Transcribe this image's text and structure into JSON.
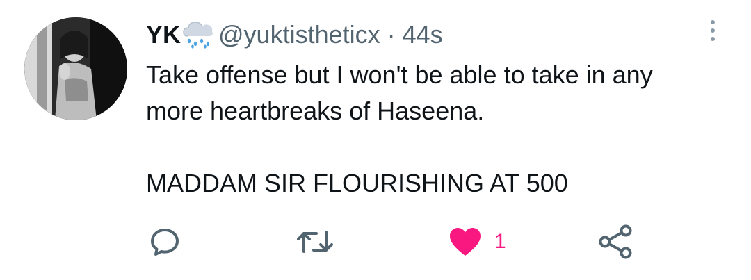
{
  "tweet": {
    "author": {
      "name": "YK",
      "emoji_icon": "cloud-with-rain-icon",
      "handle": "@yuktistheticx",
      "separator": "·",
      "time": "44s"
    },
    "text_lines": [
      "Take offense but I won't be able to take in any",
      "more heartbreaks of Haseena.",
      "MADDAM SIR FLOURISHING AT 500"
    ],
    "actions": {
      "reply_icon": "reply-bubble-icon",
      "retweet_icon": "retweet-icon",
      "like_icon": "heart-filled-icon",
      "like_count": "1",
      "share_icon": "share-icon"
    },
    "colors": {
      "text": "#0f1419",
      "secondary": "#536471",
      "like": "#f91880",
      "emoji_cloud": "#cfd8e3",
      "emoji_rain": "#4ba3e3"
    }
  }
}
